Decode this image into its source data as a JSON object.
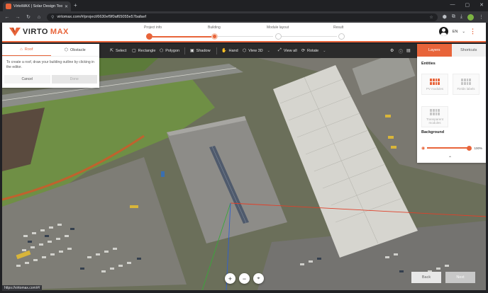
{
  "browser": {
    "tab_title": "VirtoMAX | Solar Design Tool",
    "tab_close": "✕",
    "new_tab": "+",
    "url": "virtomax.com/#/project/6630ef9f0af65055e57bafaef",
    "status_url": "https://virtomax.com/#/",
    "window_controls": [
      "—",
      "▢",
      "✕"
    ]
  },
  "header": {
    "logo_virto": "VIRTO",
    "logo_max": "MAX",
    "language": "EN",
    "language_caret": "⌄",
    "menu_dots": "⋮"
  },
  "steps": [
    {
      "label": "Project info",
      "state": "done"
    },
    {
      "label": "Building",
      "state": "active"
    },
    {
      "label": "Module layout",
      "state": "todo"
    },
    {
      "label": "Result",
      "state": "todo"
    }
  ],
  "toolbar": {
    "select": "Select",
    "rectangle": "Rectangle",
    "polygon": "Polygon",
    "shadow": "Shadow",
    "hand": "Hand",
    "view3d": "View 3D",
    "viewall": "View all",
    "rotate": "Rotate"
  },
  "left_panel": {
    "tabs": [
      "Roof",
      "Obstacle"
    ],
    "active_tab": "Roof",
    "description": "To create a roof, draw your building outline by clicking in the editor.",
    "cancel": "Cancel",
    "done": "Done"
  },
  "right_panel": {
    "tabs": [
      "Layers",
      "Shortcuts"
    ],
    "active_tab": "Layers",
    "entities_title": "Entities",
    "entities": [
      "PV modules",
      "Fields labels",
      "Transparent modules"
    ],
    "background_title": "Background",
    "background_value": "100%",
    "collapse": "⌃"
  },
  "zoom": {
    "in": "+",
    "out": "−",
    "locate": "⌖"
  },
  "footer": {
    "back": "Back",
    "next": "Next"
  },
  "colors": {
    "accent": "#e8643a",
    "toolbar": "#2b2b2b"
  }
}
